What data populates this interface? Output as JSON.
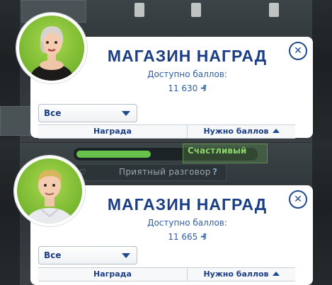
{
  "colors": {
    "title_blue": "#1a3e86",
    "accent_blue": "#2c5ea8",
    "avatar_bg": "#7ec13a",
    "moodlet_green": "#67c24c"
  },
  "panels": [
    {
      "title": "МАГАЗИН НАГРАД",
      "points_label": "Доступно баллов:",
      "points_value": "11 630",
      "points_symbol": "₰",
      "close_icon": "close-icon",
      "filter": {
        "selected": "Все"
      },
      "columns": {
        "reward": "Награда",
        "points_needed": "Нужно баллов"
      }
    },
    {
      "title": "МАГАЗИН НАГРАД",
      "points_label": "Доступно баллов:",
      "points_value": "11 665",
      "points_symbol": "₰",
      "close_icon": "close-icon",
      "filter": {
        "selected": "Все"
      },
      "columns": {
        "reward": "Награда",
        "points_needed": "Нужно баллов"
      },
      "background": {
        "moodlet": "Счастливый",
        "interaction": "Приятный разговор",
        "question_mark": "?"
      }
    }
  ]
}
